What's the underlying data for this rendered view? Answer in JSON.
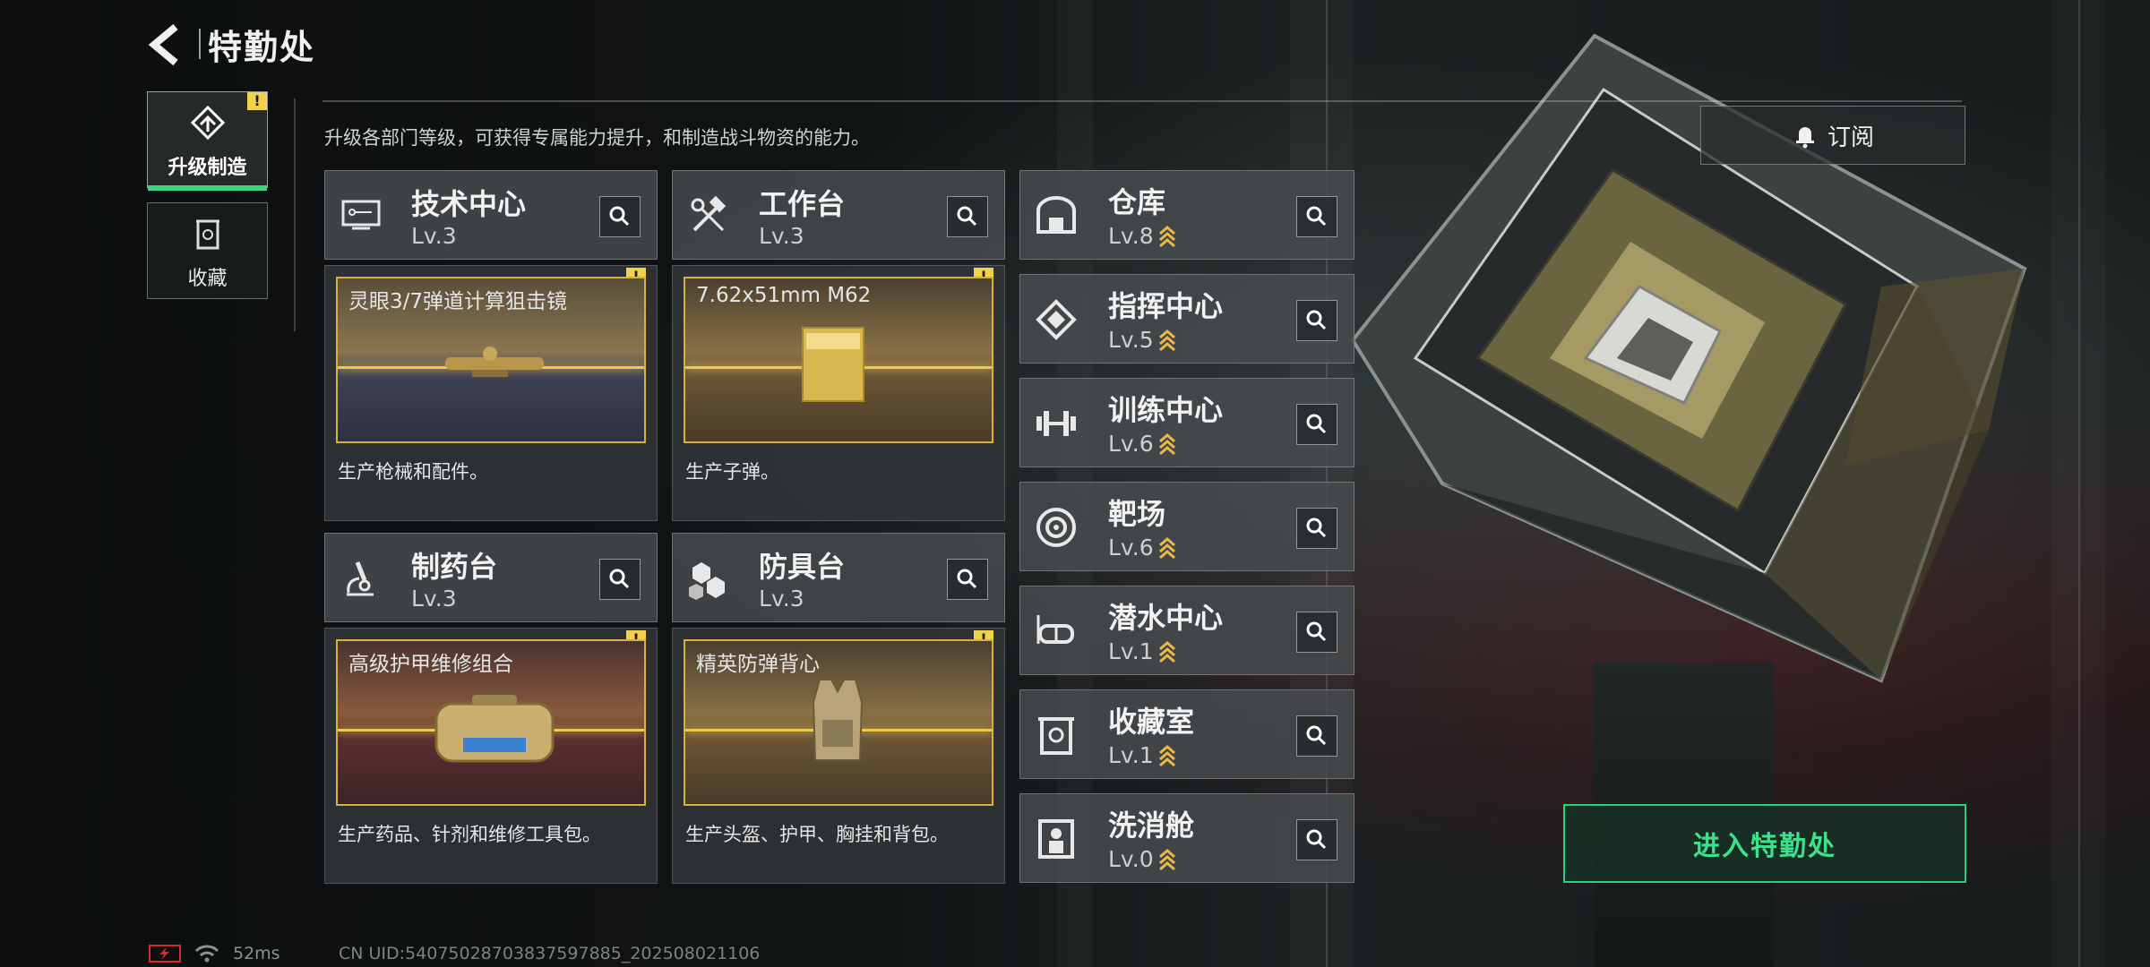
{
  "header": {
    "title": "特勤处"
  },
  "sidebar": {
    "tabs": [
      {
        "label": "升级制造",
        "active": true,
        "badge": "!"
      },
      {
        "label": "收藏",
        "active": false
      }
    ]
  },
  "main": {
    "description": "升级各部门等级，可获得专属能力提升，和制造战斗物资的能力。",
    "subscribe_label": "订阅",
    "workstations": [
      {
        "name": "技术中心",
        "level": "Lv.3",
        "product": "灵眼3/7弹道计算狙击镜",
        "desc": "生产枪械和配件。",
        "badge": "!",
        "icon": "monitor-icon"
      },
      {
        "name": "工作台",
        "level": "Lv.3",
        "product": "7.62x51mm M62",
        "desc": "生产子弹。",
        "badge": "!",
        "icon": "tools-icon"
      },
      {
        "name": "制药台",
        "level": "Lv.3",
        "product": "高级护甲维修组合",
        "desc": "生产药品、针剂和维修工具包。",
        "badge": "!",
        "icon": "microscope-icon"
      },
      {
        "name": "防具台",
        "level": "Lv.3",
        "product": "精英防弹背心",
        "desc": "生产头盔、护甲、胸挂和背包。",
        "badge": "!",
        "icon": "armor-icon"
      }
    ],
    "rooms": [
      {
        "name": "仓库",
        "level": "Lv.8",
        "icon": "warehouse-icon"
      },
      {
        "name": "指挥中心",
        "level": "Lv.5",
        "icon": "chip-icon"
      },
      {
        "name": "训练中心",
        "level": "Lv.6",
        "icon": "dumbbell-icon"
      },
      {
        "name": "靶场",
        "level": "Lv.6",
        "icon": "target-icon"
      },
      {
        "name": "潜水中心",
        "level": "Lv.1",
        "icon": "diving-mask-icon"
      },
      {
        "name": "收藏室",
        "level": "Lv.1",
        "icon": "collection-icon"
      },
      {
        "name": "洗消舱",
        "level": "Lv.0",
        "icon": "hazmat-icon"
      }
    ],
    "enter_label": "进入特勤处"
  },
  "status_bar": {
    "ping": "52ms",
    "uid": "CN UID:540750287038375978​85_202508021106"
  },
  "colors": {
    "accent_green": "#38d67e",
    "gold": "#d8b040",
    "warning": "#f2d24a",
    "battery_red": "#d52b2b"
  }
}
